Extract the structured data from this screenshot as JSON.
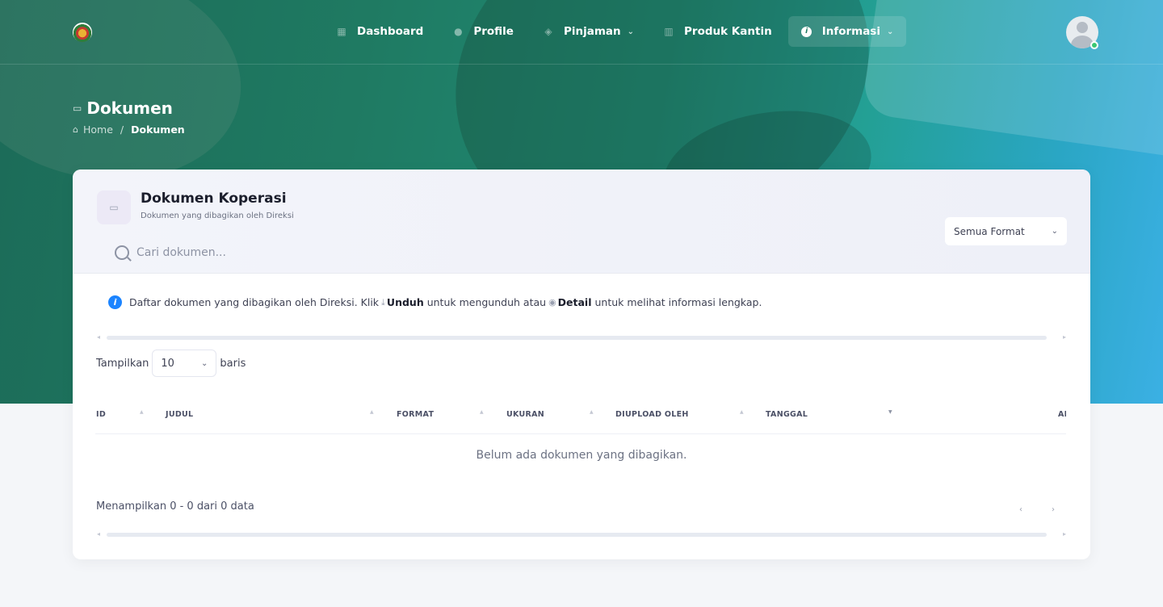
{
  "nav": {
    "items": [
      {
        "label": "Dashboard",
        "icon": "grid-icon"
      },
      {
        "label": "Profile",
        "icon": "user-icon"
      },
      {
        "label": "Pinjaman",
        "icon": "handshake-icon"
      },
      {
        "label": "Produk Kantin",
        "icon": "shop-icon"
      },
      {
        "label": "Informasi",
        "icon": "info-icon",
        "active": true
      }
    ]
  },
  "page": {
    "title": "Dokumen",
    "breadcrumb": {
      "home": "Home",
      "separator": "/",
      "current": "Dokumen"
    }
  },
  "card": {
    "title": "Dokumen Koperasi",
    "subtitle": "Dokumen yang dibagikan oleh Direksi",
    "search_placeholder": "Cari dokumen...",
    "format_select": "Semua Format"
  },
  "info": {
    "text1": "Daftar dokumen yang dibagikan oleh Direksi. Klik",
    "unduh": "Unduh",
    "text2": "untuk mengunduh atau",
    "detail": "Detail",
    "text3": "untuk melihat informasi lengkap."
  },
  "table": {
    "length_label_before": "Tampilkan",
    "length_value": "10",
    "length_label_after": "baris",
    "columns": [
      "ID",
      "JUDUL",
      "FORMAT",
      "UKURAN",
      "DIUPLOAD OLEH",
      "TANGGAL",
      "AKSI"
    ],
    "empty": "Belum ada dokumen yang dibagikan.",
    "info": "Menampilkan 0 - 0 dari 0 data",
    "prev": "‹",
    "next": "›"
  },
  "colors": {
    "hero_start": "#1c6b58",
    "hero_end": "#3bb0e4",
    "info_icon": "#1b84ff",
    "online_status": "#3cc873"
  }
}
